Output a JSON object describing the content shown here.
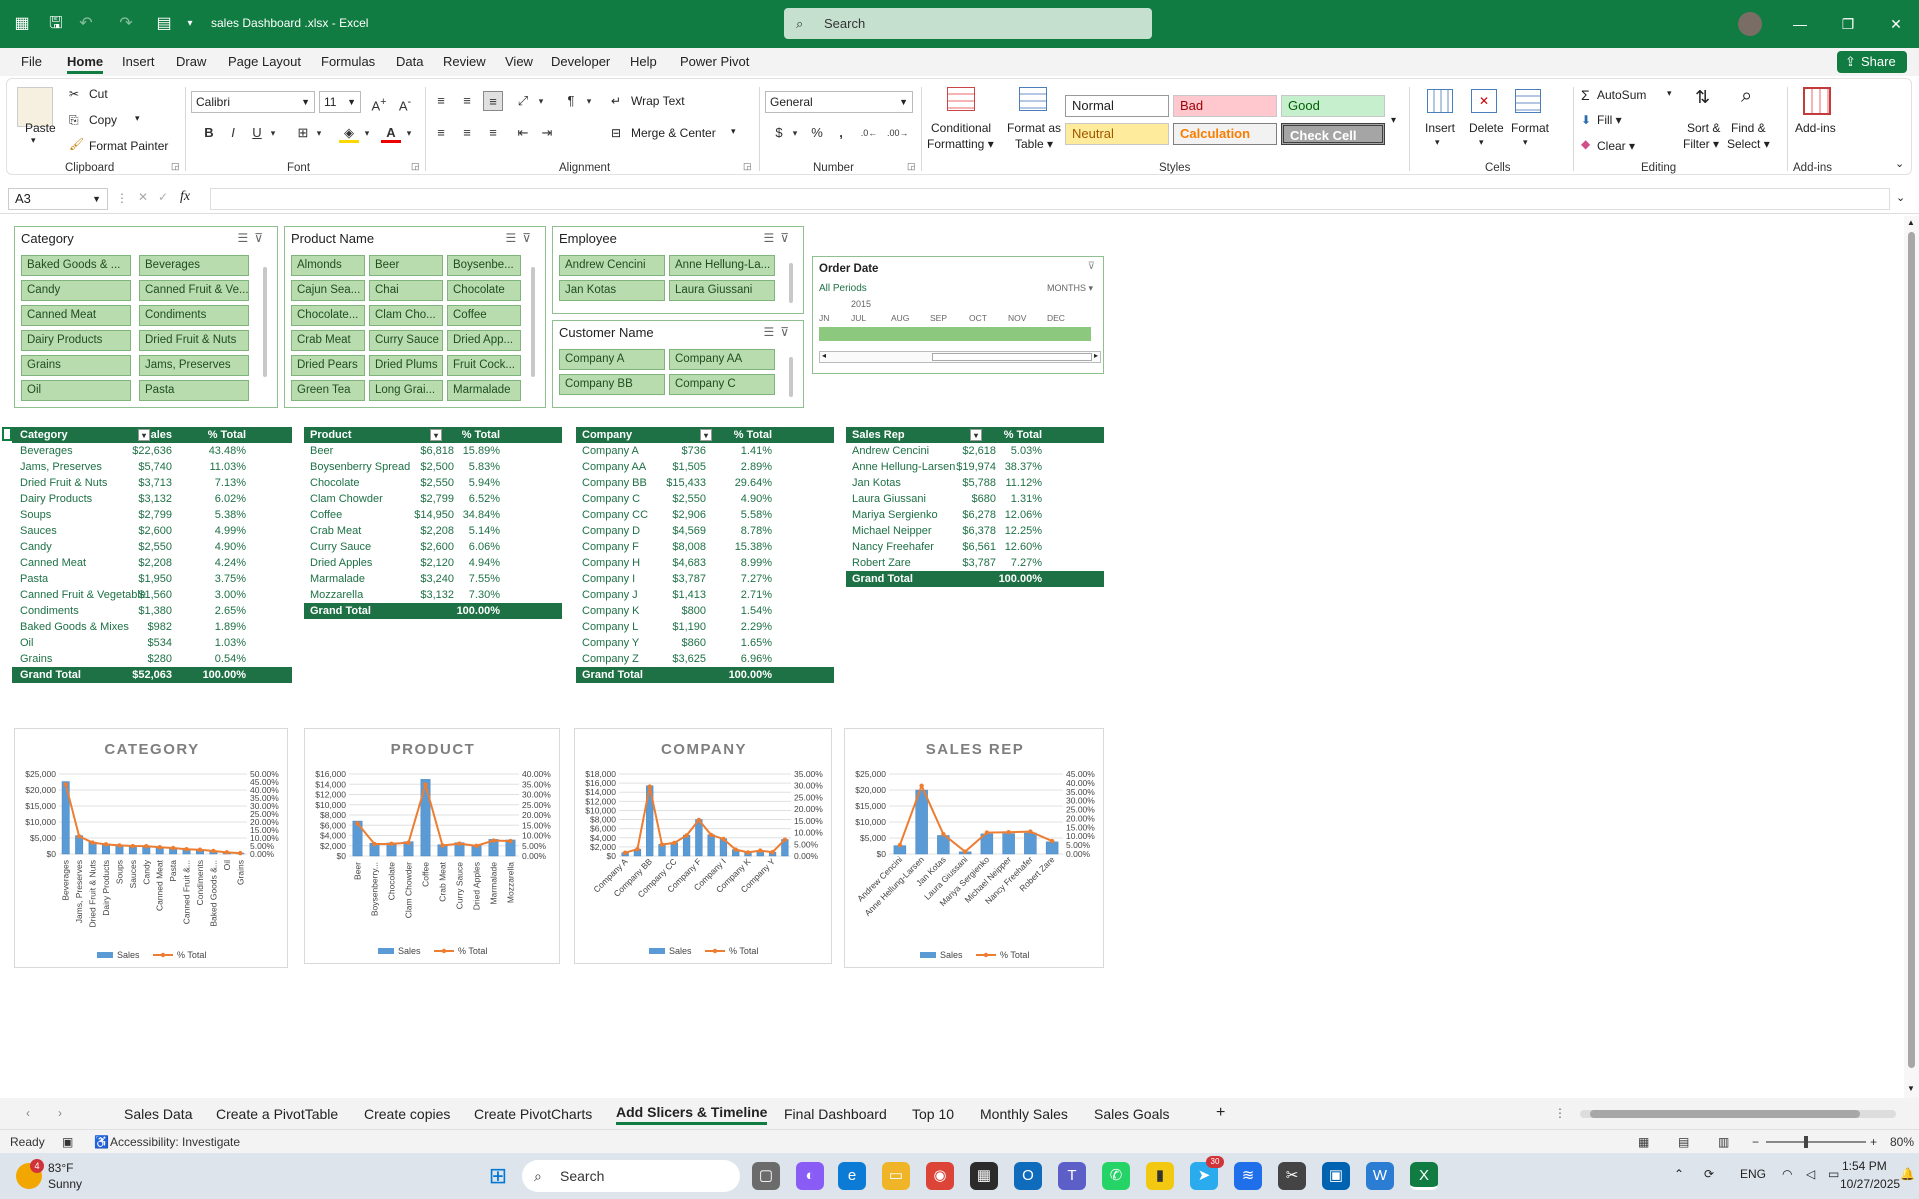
{
  "titlebar": {
    "filename": "sales Dashboard .xlsx",
    "app": "Excel",
    "search_placeholder": "Search"
  },
  "menu": [
    "File",
    "Home",
    "Insert",
    "Draw",
    "Page Layout",
    "Formulas",
    "Data",
    "Review",
    "View",
    "Developer",
    "Help",
    "Power Pivot"
  ],
  "share_label": "Share",
  "ribbon": {
    "clipboard": {
      "paste": "Paste",
      "cut": "Cut",
      "copy": "Copy",
      "format_painter": "Format Painter",
      "group": "Clipboard"
    },
    "font": {
      "name": "Calibri",
      "size": "11",
      "group": "Font"
    },
    "alignment": {
      "wrap": "Wrap Text",
      "merge": "Merge & Center",
      "group": "Alignment"
    },
    "number": {
      "format": "General",
      "group": "Number"
    },
    "styles": {
      "conditional": "Conditional",
      "conditional2": "Formatting",
      "format_as": "Format as",
      "format_as2": "Table",
      "normal": "Normal",
      "bad": "Bad",
      "good": "Good",
      "neutral": "Neutral",
      "calculation": "Calculation",
      "check": "Check Cell",
      "group": "Styles"
    },
    "cells": {
      "insert": "Insert",
      "delete": "Delete",
      "format": "Format",
      "group": "Cells"
    },
    "editing": {
      "autosum": "AutoSum",
      "fill": "Fill",
      "clear": "Clear",
      "sort": "Sort &",
      "sort2": "Filter",
      "find": "Find &",
      "find2": "Select",
      "group": "Editing"
    },
    "addins": {
      "label": "Add-ins",
      "group": "Add-ins"
    }
  },
  "namebox": "A3",
  "fx": "fx",
  "slicers": {
    "category": {
      "title": "Category",
      "items": [
        "Baked Goods & ...",
        "Beverages",
        "Candy",
        "Canned Fruit & Ve...",
        "Canned Meat",
        "Condiments",
        "Dairy Products",
        "Dried Fruit & Nuts",
        "Grains",
        "Jams, Preserves",
        "Oil",
        "Pasta"
      ]
    },
    "product": {
      "title": "Product Name",
      "items": [
        "Almonds",
        "Beer",
        "Boysenbe...",
        "Cajun Sea...",
        "Chai",
        "Chocolate",
        "Chocolate...",
        "Clam Cho...",
        "Coffee",
        "Crab Meat",
        "Curry Sauce",
        "Dried App...",
        "Dried Pears",
        "Dried Plums",
        "Fruit Cock...",
        "Green Tea",
        "Long Grai...",
        "Marmalade"
      ]
    },
    "employee": {
      "title": "Employee",
      "items": [
        "Andrew Cencini",
        "Anne Hellung-La...",
        "Jan Kotas",
        "Laura Giussani"
      ]
    },
    "customer": {
      "title": "Customer Name",
      "items": [
        "Company A",
        "Company AA",
        "Company BB",
        "Company C"
      ]
    }
  },
  "timeline": {
    "title": "Order Date",
    "periods": "All Periods",
    "unit": "MONTHS",
    "year": "2015",
    "months": [
      "JN",
      "JUL",
      "AUG",
      "SEP",
      "OCT",
      "NOV",
      "DEC"
    ]
  },
  "pivots": {
    "category": {
      "headers": [
        "Category",
        "Sales",
        "% Total"
      ],
      "rows": [
        [
          "Beverages",
          "$22,636",
          "43.48%"
        ],
        [
          "Jams, Preserves",
          "$5,740",
          "11.03%"
        ],
        [
          "Dried Fruit & Nuts",
          "$3,713",
          "7.13%"
        ],
        [
          "Dairy Products",
          "$3,132",
          "6.02%"
        ],
        [
          "Soups",
          "$2,799",
          "5.38%"
        ],
        [
          "Sauces",
          "$2,600",
          "4.99%"
        ],
        [
          "Candy",
          "$2,550",
          "4.90%"
        ],
        [
          "Canned Meat",
          "$2,208",
          "4.24%"
        ],
        [
          "Pasta",
          "$1,950",
          "3.75%"
        ],
        [
          "Canned Fruit & Vegetable",
          "$1,560",
          "3.00%"
        ],
        [
          "Condiments",
          "$1,380",
          "2.65%"
        ],
        [
          "Baked Goods & Mixes",
          "$982",
          "1.89%"
        ],
        [
          "Oil",
          "$534",
          "1.03%"
        ],
        [
          "Grains",
          "$280",
          "0.54%"
        ]
      ],
      "total": [
        "Grand Total",
        "$52,063",
        "100.00%"
      ]
    },
    "product": {
      "headers": [
        "Product",
        "",
        "% Total"
      ],
      "rows": [
        [
          "Beer",
          "$6,818",
          "15.89%"
        ],
        [
          "Boysenberry Spread",
          "$2,500",
          "5.83%"
        ],
        [
          "Chocolate",
          "$2,550",
          "5.94%"
        ],
        [
          "Clam Chowder",
          "$2,799",
          "6.52%"
        ],
        [
          "Coffee",
          "$14,950",
          "34.84%"
        ],
        [
          "Crab Meat",
          "$2,208",
          "5.14%"
        ],
        [
          "Curry Sauce",
          "$2,600",
          "6.06%"
        ],
        [
          "Dried Apples",
          "$2,120",
          "4.94%"
        ],
        [
          "Marmalade",
          "$3,240",
          "7.55%"
        ],
        [
          "Mozzarella",
          "$3,132",
          "7.30%"
        ]
      ],
      "total": [
        "Grand Total",
        "",
        "100.00%"
      ]
    },
    "company": {
      "headers": [
        "Company",
        "",
        "% Total"
      ],
      "rows": [
        [
          "Company A",
          "$736",
          "1.41%"
        ],
        [
          "Company AA",
          "$1,505",
          "2.89%"
        ],
        [
          "Company BB",
          "$15,433",
          "29.64%"
        ],
        [
          "Company C",
          "$2,550",
          "4.90%"
        ],
        [
          "Company CC",
          "$2,906",
          "5.58%"
        ],
        [
          "Company D",
          "$4,569",
          "8.78%"
        ],
        [
          "Company F",
          "$8,008",
          "15.38%"
        ],
        [
          "Company H",
          "$4,683",
          "8.99%"
        ],
        [
          "Company I",
          "$3,787",
          "7.27%"
        ],
        [
          "Company J",
          "$1,413",
          "2.71%"
        ],
        [
          "Company K",
          "$800",
          "1.54%"
        ],
        [
          "Company L",
          "$1,190",
          "2.29%"
        ],
        [
          "Company Y",
          "$860",
          "1.65%"
        ],
        [
          "Company Z",
          "$3,625",
          "6.96%"
        ]
      ],
      "total": [
        "Grand Total",
        "",
        "100.00%"
      ]
    },
    "salesrep": {
      "headers": [
        "Sales Rep",
        "",
        "% Total"
      ],
      "rows": [
        [
          "Andrew Cencini",
          "$2,618",
          "5.03%"
        ],
        [
          "Anne Hellung-Larsen",
          "$19,974",
          "38.37%"
        ],
        [
          "Jan Kotas",
          "$5,788",
          "11.12%"
        ],
        [
          "Laura Giussani",
          "$680",
          "1.31%"
        ],
        [
          "Mariya Sergienko",
          "$6,278",
          "12.06%"
        ],
        [
          "Michael Neipper",
          "$6,378",
          "12.25%"
        ],
        [
          "Nancy Freehafer",
          "$6,561",
          "12.60%"
        ],
        [
          "Robert Zare",
          "$3,787",
          "7.27%"
        ]
      ],
      "total": [
        "Grand Total",
        "",
        "100.00%"
      ]
    }
  },
  "chart_data": [
    {
      "type": "bar",
      "title": "CATEGORY",
      "categories": [
        "Beverages",
        "Jams, Preserves",
        "Dried Fruit & Nuts",
        "Dairy Products",
        "Soups",
        "Sauces",
        "Candy",
        "Canned Meat",
        "Pasta",
        "Canned Fruit &...",
        "Condiments",
        "Baked Goods &...",
        "Oil",
        "Grains"
      ],
      "series": [
        {
          "name": "Sales",
          "values": [
            22636,
            5740,
            3713,
            3132,
            2799,
            2600,
            2550,
            2208,
            1950,
            1560,
            1380,
            982,
            534,
            280
          ]
        },
        {
          "name": "% Total",
          "values": [
            43.48,
            11.03,
            7.13,
            6.02,
            5.38,
            4.99,
            4.9,
            4.24,
            3.75,
            3.0,
            2.65,
            1.89,
            1.03,
            0.54
          ]
        }
      ],
      "ylim": [
        0,
        25000
      ],
      "y2lim": [
        0,
        50
      ],
      "yticks": [
        "$0",
        "$5,000",
        "$10,000",
        "$15,000",
        "$20,000",
        "$25,000"
      ],
      "y2ticks": [
        "0.00%",
        "5.00%",
        "10.00%",
        "15.00%",
        "20.00%",
        "25.00%",
        "30.00%",
        "35.00%",
        "40.00%",
        "45.00%",
        "50.00%"
      ],
      "legend": [
        "Sales",
        "% Total"
      ]
    },
    {
      "type": "bar",
      "title": "PRODUCT",
      "categories": [
        "Beer",
        "Boysenberry...",
        "Chocolate",
        "Clam Chowder",
        "Coffee",
        "Crab Meat",
        "Curry Sauce",
        "Dried Apples",
        "Marmalade",
        "Mozzarella"
      ],
      "series": [
        {
          "name": "Sales",
          "values": [
            6818,
            2500,
            2550,
            2799,
            14950,
            2208,
            2600,
            2120,
            3240,
            3132
          ]
        },
        {
          "name": "% Total",
          "values": [
            15.89,
            5.83,
            5.94,
            6.52,
            34.84,
            5.14,
            6.06,
            4.94,
            7.55,
            7.3
          ]
        }
      ],
      "ylim": [
        0,
        16000
      ],
      "y2lim": [
        0,
        40
      ],
      "yticks": [
        "$0",
        "$2,000",
        "$4,000",
        "$6,000",
        "$8,000",
        "$10,000",
        "$12,000",
        "$14,000",
        "$16,000"
      ],
      "y2ticks": [
        "0.00%",
        "5.00%",
        "10.00%",
        "15.00%",
        "20.00%",
        "25.00%",
        "30.00%",
        "35.00%",
        "40.00%"
      ],
      "legend": [
        "Sales",
        "% Total"
      ]
    },
    {
      "type": "bar",
      "title": "COMPANY",
      "categories": [
        "Company A",
        "Company AA",
        "Company BB",
        "Company C",
        "Company CC",
        "Company D",
        "Company F",
        "Company H",
        "Company I",
        "Company J",
        "Company K",
        "Company L",
        "Company Y",
        "Company Z"
      ],
      "xtick_labels": [
        "Company A",
        "",
        "Company BB",
        "",
        "Company CC",
        "",
        "Company F",
        "",
        "Company I",
        "",
        "Company K",
        "",
        "Company Y",
        ""
      ],
      "series": [
        {
          "name": "Sales",
          "values": [
            736,
            1505,
            15433,
            2550,
            2906,
            4569,
            8008,
            4683,
            3787,
            1413,
            800,
            1190,
            860,
            3625
          ]
        },
        {
          "name": "% Total",
          "values": [
            1.41,
            2.89,
            29.64,
            4.9,
            5.58,
            8.78,
            15.38,
            8.99,
            7.27,
            2.71,
            1.54,
            2.29,
            1.65,
            6.96
          ]
        }
      ],
      "ylim": [
        0,
        18000
      ],
      "y2lim": [
        0,
        35
      ],
      "yticks": [
        "$0",
        "$2,000",
        "$4,000",
        "$6,000",
        "$8,000",
        "$10,000",
        "$12,000",
        "$14,000",
        "$16,000",
        "$18,000"
      ],
      "y2ticks": [
        "0.00%",
        "5.00%",
        "10.00%",
        "15.00%",
        "20.00%",
        "25.00%",
        "30.00%",
        "35.00%"
      ],
      "legend": [
        "Sales",
        "% Total"
      ]
    },
    {
      "type": "bar",
      "title": "SALES REP",
      "categories": [
        "Andrew Cencini",
        "Anne Hellung-Larsen",
        "Jan Kotas",
        "Laura Giussani",
        "Mariya Sergienko",
        "Michael Neipper",
        "Nancy Freehafer",
        "Robert Zare"
      ],
      "series": [
        {
          "name": "Sales",
          "values": [
            2618,
            19974,
            5788,
            680,
            6278,
            6378,
            6561,
            3787
          ]
        },
        {
          "name": "% Total",
          "values": [
            5.03,
            38.37,
            11.12,
            1.31,
            12.06,
            12.25,
            12.6,
            7.27
          ]
        }
      ],
      "ylim": [
        0,
        25000
      ],
      "y2lim": [
        0,
        45
      ],
      "yticks": [
        "$0",
        "$5,000",
        "$10,000",
        "$15,000",
        "$20,000",
        "$25,000"
      ],
      "y2ticks": [
        "0.00%",
        "5.00%",
        "10.00%",
        "15.00%",
        "20.00%",
        "25.00%",
        "30.00%",
        "35.00%",
        "40.00%",
        "45.00%"
      ],
      "legend": [
        "Sales",
        "% Total"
      ]
    }
  ],
  "sheet_tabs": [
    "Sales Data",
    "Create a PivotTable",
    "Create copies",
    "Create PivotCharts",
    "Add Slicers & Timeline",
    "Final Dashboard",
    "Top 10",
    "Monthly Sales",
    "Sales Goals"
  ],
  "active_tab": "Add Slicers & Timeline",
  "status": {
    "ready": "Ready",
    "accessibility": "Accessibility: Investigate",
    "zoom": "80%"
  },
  "taskbar": {
    "temp": "83°F",
    "weather": "Sunny",
    "badge": "4",
    "search": "Search",
    "lang": "ENG",
    "time": "1:54 PM",
    "date": "10/27/2025",
    "telegram_badge": "30"
  },
  "colors": {
    "excel_green": "#107c41",
    "pivot_green": "#1e7145",
    "bar_blue": "#5b9bd5",
    "line_orange": "#ed7d31"
  }
}
